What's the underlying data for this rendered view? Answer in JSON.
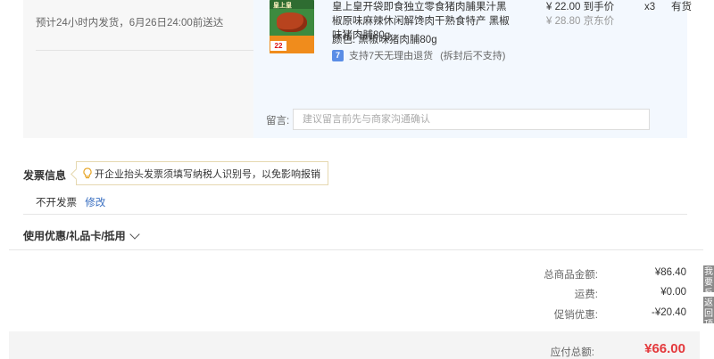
{
  "delivery": {
    "note": "预计24小时内发货，6月26日24:00前送达"
  },
  "goods": {
    "thumb_brand": "皇上皇",
    "thumb_badge": "22",
    "title": "皇上皇开袋即食独立零食猪肉脯果汁黑椒原味麻辣休闲解馋肉干熟食特产 黑椒味猪肉脯80g",
    "price_now": "¥ 22.00 到手价",
    "price_old": "¥ 28.80 京东价",
    "quantity": "x3",
    "stock": "有货",
    "spec_key": "颜色:",
    "spec_value": "黑椒味猪肉脯80g",
    "return_icon": "7",
    "return_text": "支持7天无理由退货",
    "return_paren": "(拆封后不支持)"
  },
  "remark": {
    "label": "留言:",
    "placeholder": "建议留言前先与商家沟通确认"
  },
  "invoice": {
    "title": "发票信息",
    "tip": "开企业抬头发票须填写纳税人识别号，以免影响报销",
    "value": "不开发票",
    "edit": "修改"
  },
  "coupon": {
    "label": "使用优惠/礼品卡/抵用"
  },
  "summary": {
    "goods_total_label": "总商品金额:",
    "goods_total_value": "¥86.40",
    "freight_label": "运费:",
    "freight_value": "¥0.00",
    "discount_label": "促销优惠:",
    "discount_value": "-¥20.40",
    "payable_label": "应付总额:",
    "payable_value": "¥66.00"
  },
  "side_tabs": {
    "feedback": "我要反馈",
    "back_top": "返回顶部"
  },
  "colors": {
    "accent_red": "#e4393c",
    "link_blue": "#3a6fc1",
    "goods_panel_bg": "#f3f8fe"
  }
}
